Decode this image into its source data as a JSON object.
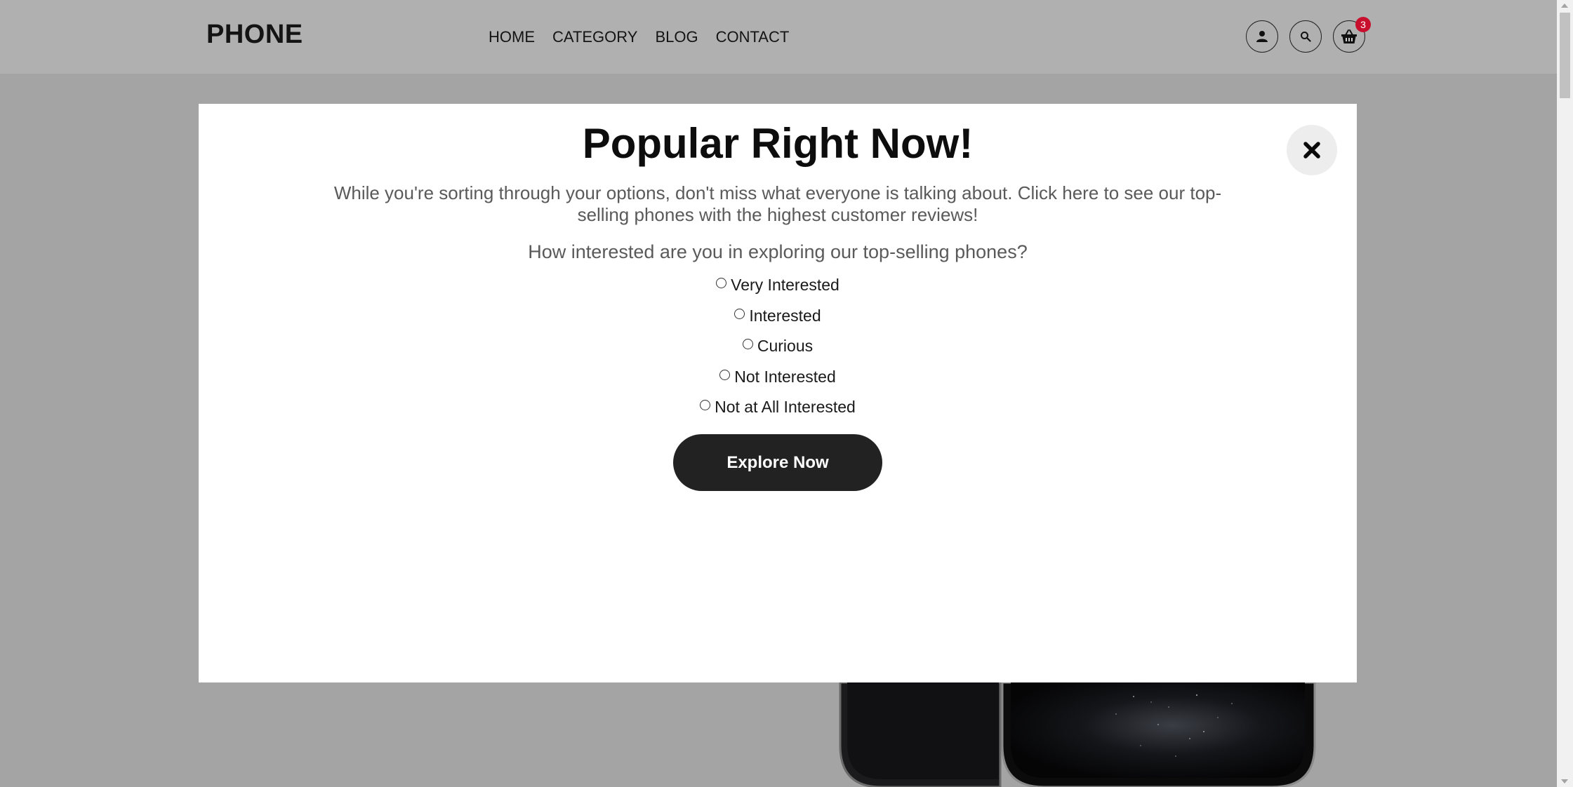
{
  "header": {
    "logo": "PHONE",
    "nav": [
      "HOME",
      "CATEGORY",
      "BLOG",
      "CONTACT"
    ],
    "icons": [
      "user-icon",
      "search-icon",
      "basket-icon"
    ],
    "cart_count": "3"
  },
  "modal": {
    "title": "Popular Right Now!",
    "description": "While you're sorting through your options, don't miss what everyone is talking about. Click here to see our top-selling phones with the highest customer reviews!",
    "question": "How interested are you in exploring our top-selling phones?",
    "options": [
      "Very Interested",
      "Interested",
      "Curious",
      "Not Interested",
      "Not at All Interested"
    ],
    "button_label": "Explore Now",
    "close_icon": "close-icon"
  },
  "colors": {
    "overlay": "#a4a4a4",
    "header_bg": "#b0b0b0",
    "button_bg": "#222222",
    "badge": "#c8102e"
  }
}
